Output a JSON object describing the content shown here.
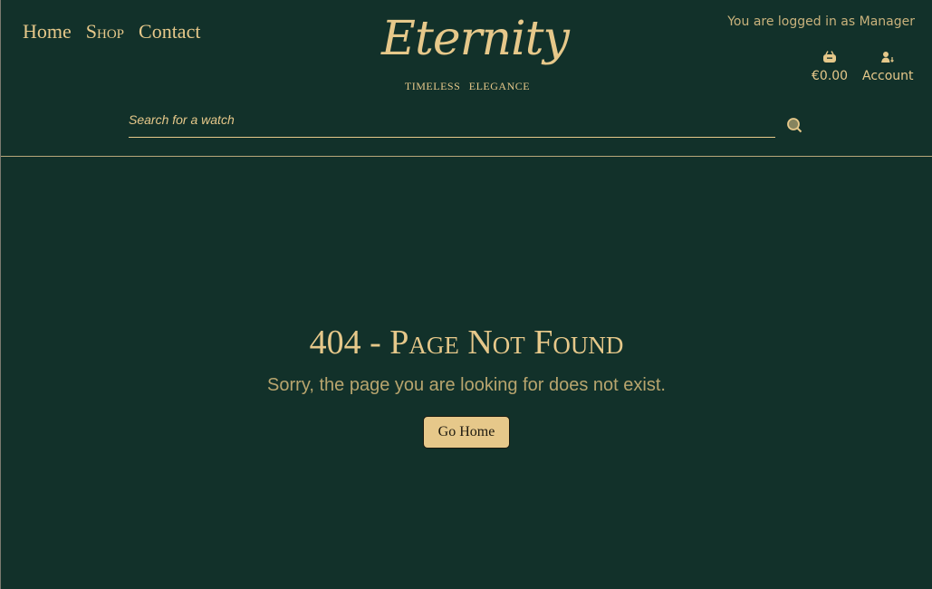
{
  "nav": {
    "items": [
      {
        "label": "Home"
      },
      {
        "label": "Shop"
      },
      {
        "label": "Contact"
      }
    ]
  },
  "logo": {
    "name": "Eternity",
    "tagline": "TIMELESS ELEGANCE"
  },
  "user": {
    "status": "You are logged in as Manager"
  },
  "cart": {
    "total": "€0.00",
    "icon": "basket-icon"
  },
  "account": {
    "label": "Account",
    "icon": "account-icon"
  },
  "search": {
    "placeholder": "Search for a watch",
    "value": "",
    "icon": "search-icon"
  },
  "error": {
    "title": "404 - Page Not Found",
    "message": "Sorry, the page you are looking for does not exist.",
    "button": "Go Home"
  },
  "colors": {
    "background": "#12312a",
    "accent": "#e6c88a"
  }
}
